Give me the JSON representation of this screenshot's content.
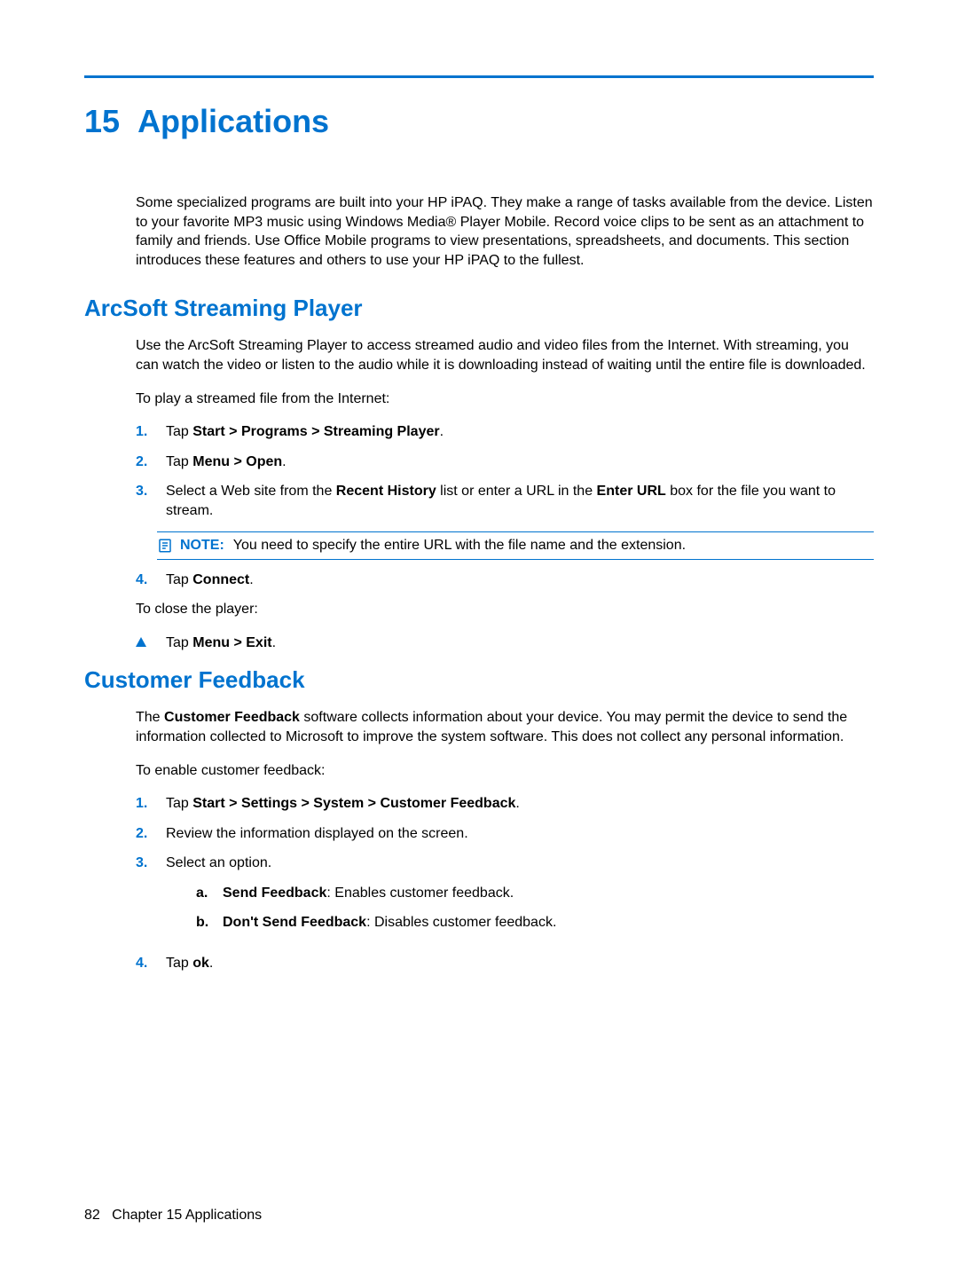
{
  "chapter": {
    "number": "15",
    "title": "Applications"
  },
  "intro": "Some specialized programs are built into your HP iPAQ. They make a range of tasks available from the device. Listen to your favorite MP3 music using Windows Media® Player Mobile. Record voice clips to be sent as an attachment to family and friends. Use Office Mobile programs to view presentations, spreadsheets, and documents. This section introduces these features and others to use your HP iPAQ to the fullest.",
  "section1": {
    "title": "ArcSoft Streaming Player",
    "p1": "Use the ArcSoft Streaming Player to access streamed audio and video files from the Internet. With streaming, you can watch the video or listen to the audio while it is downloading instead of waiting until the entire file is downloaded.",
    "p2": "To play a streamed file from the Internet:",
    "steps": [
      {
        "n": "1.",
        "pre": "Tap ",
        "bold": "Start > Programs > Streaming Player",
        "post": "."
      },
      {
        "n": "2.",
        "pre": "Tap ",
        "bold": "Menu > Open",
        "post": "."
      },
      {
        "n": "3.",
        "pre": "Select a Web site from the ",
        "bold": "Recent History",
        "mid": " list or enter a URL in the ",
        "bold2": "Enter URL",
        "post": " box for the file you want to stream."
      }
    ],
    "note": {
      "label": "NOTE:",
      "text": "You need to specify the entire URL with the file name and the extension."
    },
    "step4": {
      "n": "4.",
      "pre": "Tap ",
      "bold": "Connect",
      "post": "."
    },
    "p3": "To close the player:",
    "bullet": {
      "pre": "Tap ",
      "bold": "Menu > Exit",
      "post": "."
    }
  },
  "section2": {
    "title": "Customer Feedback",
    "p1_pre": "The ",
    "p1_bold": "Customer Feedback",
    "p1_post": " software collects information about your device. You may permit the device to send the information collected to Microsoft to improve the system software. This does not collect any personal information.",
    "p2": "To enable customer feedback:",
    "steps": [
      {
        "n": "1.",
        "pre": "Tap ",
        "bold": "Start > Settings > System > Customer Feedback",
        "post": "."
      },
      {
        "n": "2.",
        "text": "Review the information displayed on the screen."
      },
      {
        "n": "3.",
        "text": "Select an option.",
        "subs": [
          {
            "m": "a.",
            "bold": "Send Feedback",
            "post": ": Enables customer feedback."
          },
          {
            "m": "b.",
            "bold": "Don't Send Feedback",
            "post": ": Disables customer feedback."
          }
        ]
      },
      {
        "n": "4.",
        "pre": "Tap ",
        "bold": "ok",
        "post": "."
      }
    ]
  },
  "footer": {
    "page": "82",
    "label": "Chapter 15   Applications"
  }
}
